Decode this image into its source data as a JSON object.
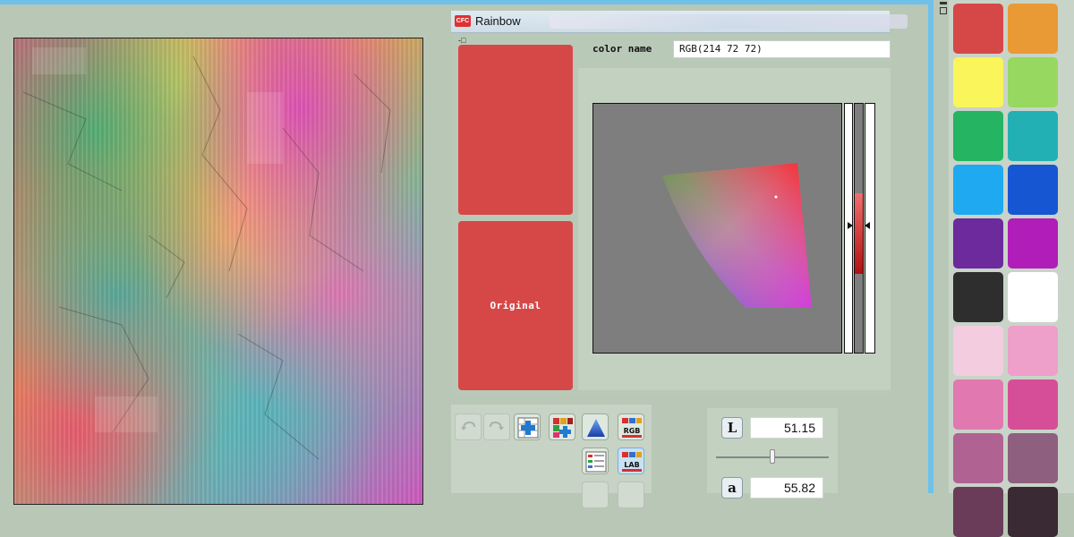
{
  "window": {
    "title": "Rainbow",
    "logo_text": "CFC"
  },
  "color_name": {
    "label": "color name",
    "value": "RGB(214 72 72)"
  },
  "swatches": {
    "current_color": "#d64848",
    "original_label": "Original"
  },
  "lab": {
    "l_label": "L",
    "l_value": "51.15",
    "a_label": "a",
    "a_value": "55.82"
  },
  "toolbar": {
    "rgb_label": "RGB",
    "lab_label": "LAB",
    "icons": [
      "undo-icon",
      "redo-icon",
      "add-grid-icon",
      "add-palette-icon",
      "triangle-icon",
      "rgb-icon",
      "list-icon",
      "lab-icon"
    ]
  },
  "palette": {
    "colors": [
      "#d64848",
      "#e99a34",
      "#f9f55a",
      "#97d861",
      "#25b461",
      "#23b0b4",
      "#1fa9f1",
      "#1656d2",
      "#6c2a9c",
      "#b01db8",
      "#2e2e2e",
      "#ffffff",
      "#f3cce0",
      "#ee9fca",
      "#e278b0",
      "#d64e98",
      "#b06292",
      "#8e5f7e",
      "#6a3c5a",
      "#3a2a33"
    ]
  }
}
